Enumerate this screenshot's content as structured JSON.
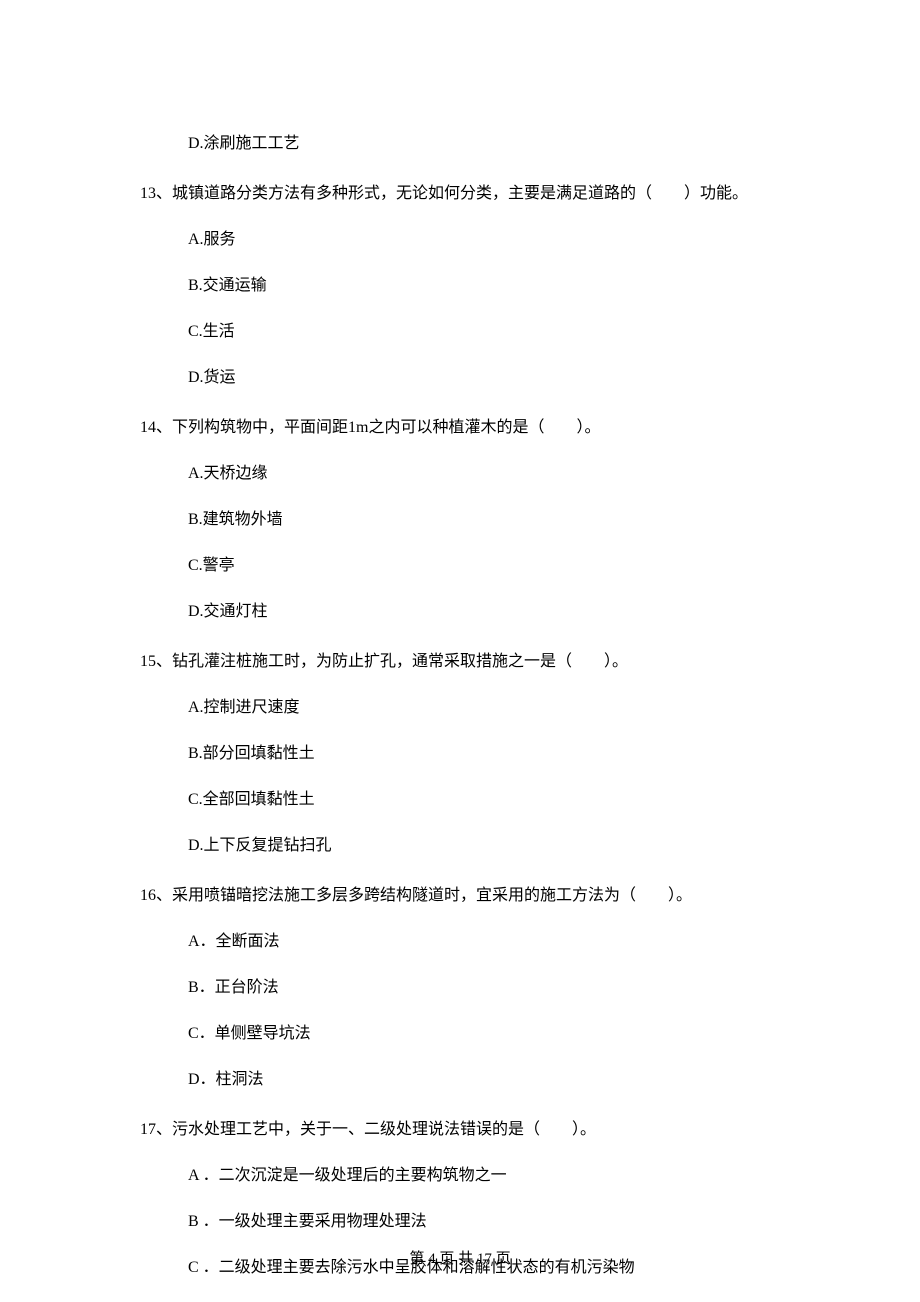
{
  "options_leading": {
    "d": "D.涂刷施工工艺"
  },
  "q13": {
    "num": "13、",
    "text": "城镇道路分类方法有多种形式，无论如何分类，主要是满足道路的（　　）功能。",
    "a": "A.服务",
    "b": "B.交通运输",
    "c": "C.生活",
    "d": "D.货运"
  },
  "q14": {
    "num": "14、",
    "text": "下列构筑物中，平面间距1m之内可以种植灌木的是（　　）。",
    "a": "A.天桥边缘",
    "b": "B.建筑物外墙",
    "c": "C.警亭",
    "d": "D.交通灯柱"
  },
  "q15": {
    "num": "15、",
    "text": "钻孔灌注桩施工时，为防止扩孔，通常采取措施之一是（　　）。",
    "a": "A.控制进尺速度",
    "b": "B.部分回填黏性土",
    "c": "C.全部回填黏性土",
    "d": "D.上下反复提钻扫孔"
  },
  "q16": {
    "num": "16、",
    "text": "采用喷锚暗挖法施工多层多跨结构隧道时，宜采用的施工方法为（　　）。",
    "a": "A．全断面法",
    "b": "B．正台阶法",
    "c": "C．单侧壁导坑法",
    "d": "D．柱洞法"
  },
  "q17": {
    "num": "17、",
    "text": "污水处理工艺中，关于一、二级处理说法错误的是（　　）。",
    "a": "A ．二次沉淀是一级处理后的主要构筑物之一",
    "b": "B ．一级处理主要采用物理处理法",
    "c": "C ．二级处理主要去除污水中呈胶体和溶解性状态的有机污染物"
  },
  "footer": "第 4 页 共 17 页"
}
